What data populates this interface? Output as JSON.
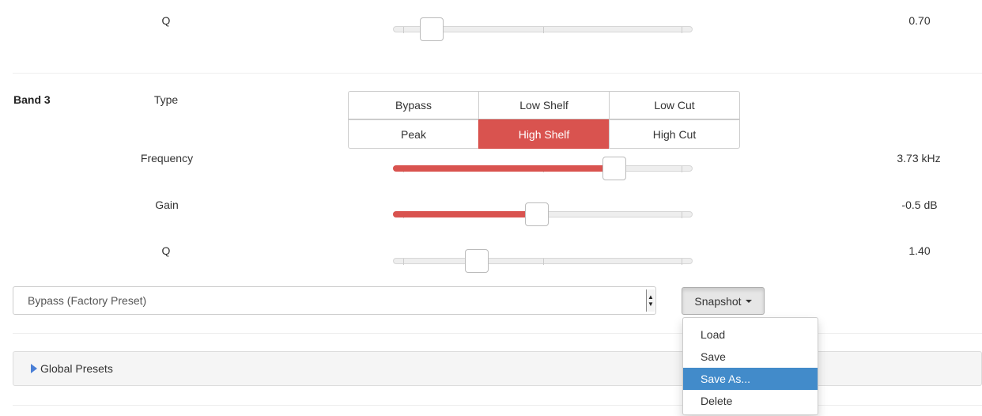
{
  "band2": {
    "q_label": "Q",
    "q_value": "0.70",
    "q_level": 0.13
  },
  "band3": {
    "title": "Band 3",
    "type_label": "Type",
    "types": [
      "Bypass",
      "Low Shelf",
      "Low Cut",
      "Peak",
      "High Shelf",
      "High Cut"
    ],
    "selected_type": "High Shelf",
    "frequency_label": "Frequency",
    "frequency_value": "3.73 kHz",
    "frequency_level": 0.74,
    "gain_label": "Gain",
    "gain_value": "-0.5 dB",
    "gain_level": 0.48,
    "q_label": "Q",
    "q_value": "1.40",
    "q_level": 0.28
  },
  "preset": {
    "selected": "Bypass (Factory Preset)"
  },
  "snapshot": {
    "label": "Snapshot",
    "menu": [
      "Load",
      "Save",
      "Save As...",
      "Delete"
    ],
    "highlighted": "Save As..."
  },
  "global_presets": {
    "label": "Global Presets"
  },
  "colors": {
    "accent": "#d9534f",
    "menu_highlight": "#428bca",
    "expand_icon": "#4a7fd6"
  }
}
